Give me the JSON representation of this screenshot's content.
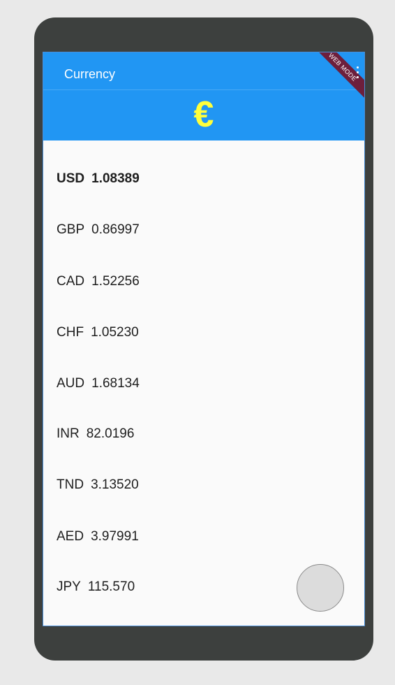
{
  "appbar": {
    "title": "Currency",
    "ribbon": "WEB MODE",
    "menu_icon": "more-vert-icon",
    "symbol": "€",
    "background": "#2196f3",
    "symbol_color": "#ffff3b"
  },
  "rates": [
    {
      "code": "USD",
      "value": "1.08389",
      "selected": true
    },
    {
      "code": "GBP",
      "value": "0.86997",
      "selected": false
    },
    {
      "code": "CAD",
      "value": "1.52256",
      "selected": false
    },
    {
      "code": "CHF",
      "value": "1.05230",
      "selected": false
    },
    {
      "code": "AUD",
      "value": "1.68134",
      "selected": false
    },
    {
      "code": "INR",
      "value": "82.0196",
      "selected": false
    },
    {
      "code": "TND",
      "value": "3.13520",
      "selected": false
    },
    {
      "code": "AED",
      "value": "3.97991",
      "selected": false
    },
    {
      "code": "JPY",
      "value": "115.570",
      "selected": false
    }
  ],
  "fab": {
    "color": "#dcdcdc"
  }
}
